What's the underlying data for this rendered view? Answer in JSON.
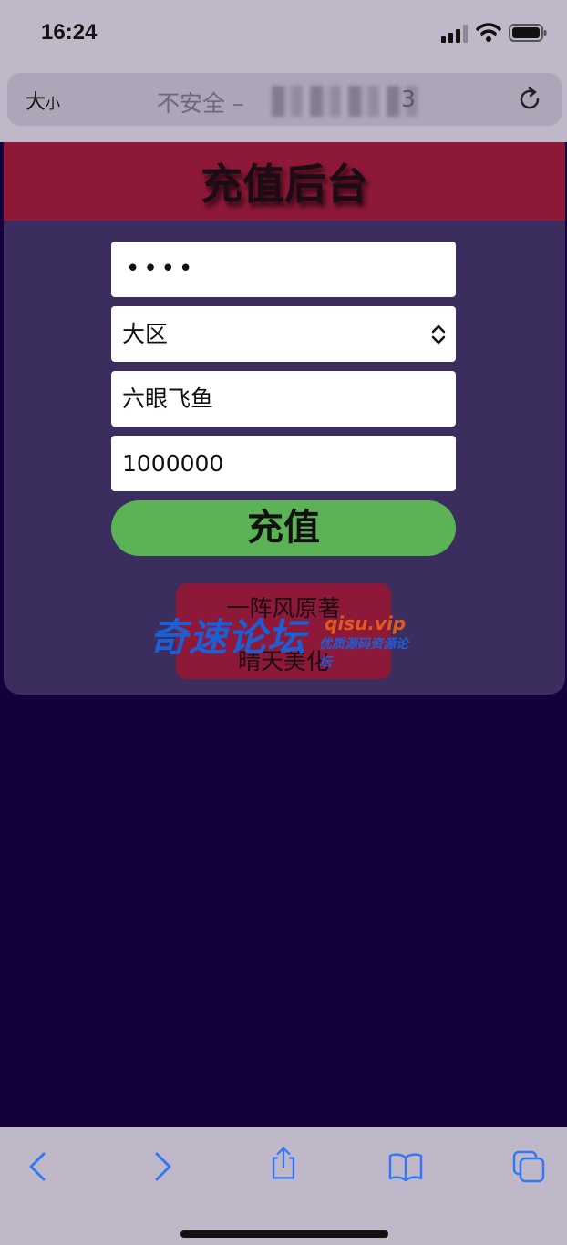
{
  "status_bar": {
    "time": "16:24"
  },
  "url_bar": {
    "text_size_label_big": "大",
    "text_size_label_small": "小",
    "url_text": "不安全 –",
    "url_tail": "3"
  },
  "page": {
    "title": "充值后台",
    "password_value": "••••",
    "region_select_value": "大区",
    "role_name_value": "六眼飞鱼",
    "amount_value": "1000000",
    "submit_label": "充值",
    "credit_line_1": "一阵风原著",
    "credit_line_2": "晴天美化"
  },
  "watermark": {
    "main_text": "奇速论坛",
    "domain": "qisu.vip",
    "slogan": "优质源码资源论坛"
  },
  "colors": {
    "page_background": "#14003a",
    "card_background": "#3b2d5e",
    "header_background": "#8e1838",
    "button_green": "#5cb355",
    "ios_link_blue": "#3478f6"
  },
  "icons": {
    "signal": "signal-icon",
    "wifi": "wifi-icon",
    "battery": "battery-icon",
    "reload": "reload-icon",
    "select_arrow": "chevron-updown-icon",
    "back": "chevron-left-icon",
    "forward": "chevron-right-icon",
    "share": "share-icon",
    "bookmarks": "book-icon",
    "tabs": "tabs-icon"
  }
}
